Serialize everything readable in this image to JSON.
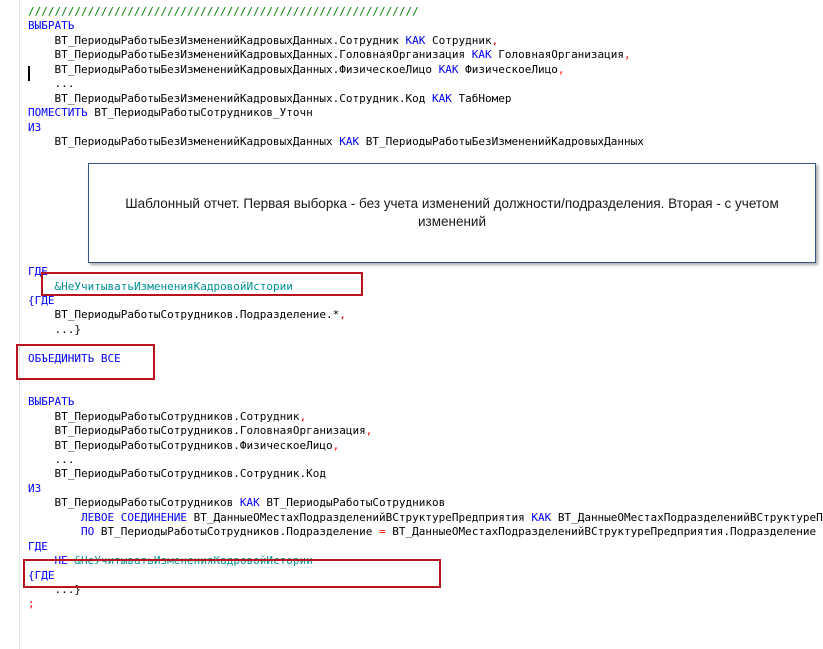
{
  "code_lines": [
    {
      "segs": [
        {
          "t": "///////////////////////////////////////////////////////////",
          "c": "cmt"
        }
      ]
    },
    {
      "segs": [
        {
          "t": "ВЫБРАТЬ",
          "c": "kw"
        }
      ]
    },
    {
      "segs": [
        {
          "t": "    ВТ_ПериодыРаботыБезИзмененийКадровыхДанных.Сотрудник ",
          "c": ""
        },
        {
          "t": "КАК",
          "c": "kw"
        },
        {
          "t": " Сотрудник",
          "c": ""
        },
        {
          "t": ",",
          "c": "op"
        }
      ]
    },
    {
      "segs": [
        {
          "t": "    ВТ_ПериодыРаботыБезИзмененийКадровыхДанных.ГоловнаяОрганизация ",
          "c": ""
        },
        {
          "t": "КАК",
          "c": "kw"
        },
        {
          "t": " ГоловнаяОрганизация",
          "c": ""
        },
        {
          "t": ",",
          "c": "op"
        }
      ]
    },
    {
      "segs": [
        {
          "t": "    ВТ_ПериодыРаботыБезИзмененийКадровыхДанных.ФизическоеЛицо ",
          "c": ""
        },
        {
          "t": "КАК",
          "c": "kw"
        },
        {
          "t": " ФизическоеЛицо",
          "c": ""
        },
        {
          "t": ",",
          "c": "op"
        }
      ]
    },
    {
      "segs": [
        {
          "t": "    ...",
          "c": ""
        }
      ]
    },
    {
      "segs": [
        {
          "t": "    ВТ_ПериодыРаботыБезИзмененийКадровыхДанных.Сотрудник.Код ",
          "c": ""
        },
        {
          "t": "КАК",
          "c": "kw"
        },
        {
          "t": " ТабНомер",
          "c": ""
        }
      ]
    },
    {
      "segs": [
        {
          "t": "ПОМЕСТИТЬ",
          "c": "kw"
        },
        {
          "t": " ВТ_ПериодыРаботыСотрудников_Уточн",
          "c": ""
        }
      ]
    },
    {
      "segs": [
        {
          "t": "ИЗ",
          "c": "kw"
        }
      ]
    },
    {
      "segs": [
        {
          "t": "    ВТ_ПериодыРаботыБезИзмененийКадровыхДанных ",
          "c": ""
        },
        {
          "t": "КАК",
          "c": "kw"
        },
        {
          "t": " ВТ_ПериодыРаботыБезИзмененийКадровыхДанных",
          "c": ""
        }
      ]
    },
    {
      "segs": [
        {
          "t": "",
          "c": ""
        }
      ]
    },
    {
      "segs": [
        {
          "t": "",
          "c": ""
        }
      ]
    },
    {
      "segs": [
        {
          "t": "",
          "c": ""
        }
      ]
    },
    {
      "segs": [
        {
          "t": "",
          "c": ""
        }
      ]
    },
    {
      "segs": [
        {
          "t": "",
          "c": ""
        }
      ]
    },
    {
      "segs": [
        {
          "t": "",
          "c": ""
        }
      ]
    },
    {
      "segs": [
        {
          "t": "",
          "c": ""
        }
      ]
    },
    {
      "segs": [
        {
          "t": "",
          "c": ""
        }
      ]
    },
    {
      "segs": [
        {
          "t": "ГДЕ",
          "c": "kw"
        }
      ]
    },
    {
      "segs": [
        {
          "t": "    ",
          "c": ""
        },
        {
          "t": "&НеУчитыватьИзмененияКадровойИстории",
          "c": "param"
        }
      ]
    },
    {
      "segs": [
        {
          "t": "{ГДЕ",
          "c": "kw"
        }
      ]
    },
    {
      "segs": [
        {
          "t": "    ВТ_ПериодыРаботыСотрудников.Подразделение.*",
          "c": ""
        },
        {
          "t": ",",
          "c": "op"
        }
      ]
    },
    {
      "segs": [
        {
          "t": "    ...}",
          "c": ""
        }
      ]
    },
    {
      "segs": [
        {
          "t": "",
          "c": ""
        }
      ]
    },
    {
      "segs": [
        {
          "t": "ОБЪЕДИНИТЬ ВСЕ",
          "c": "kw"
        }
      ]
    },
    {
      "segs": [
        {
          "t": "",
          "c": ""
        }
      ]
    },
    {
      "segs": [
        {
          "t": "",
          "c": ""
        }
      ]
    },
    {
      "segs": [
        {
          "t": "ВЫБРАТЬ",
          "c": "kw"
        }
      ]
    },
    {
      "segs": [
        {
          "t": "    ВТ_ПериодыРаботыСотрудников.Сотрудник",
          "c": ""
        },
        {
          "t": ",",
          "c": "op"
        }
      ]
    },
    {
      "segs": [
        {
          "t": "    ВТ_ПериодыРаботыСотрудников.ГоловнаяОрганизация",
          "c": ""
        },
        {
          "t": ",",
          "c": "op"
        }
      ]
    },
    {
      "segs": [
        {
          "t": "    ВТ_ПериодыРаботыСотрудников.ФизическоеЛицо",
          "c": ""
        },
        {
          "t": ",",
          "c": "op"
        }
      ]
    },
    {
      "segs": [
        {
          "t": "    ...",
          "c": ""
        }
      ]
    },
    {
      "segs": [
        {
          "t": "    ВТ_ПериодыРаботыСотрудников.Сотрудник.Код",
          "c": ""
        }
      ]
    },
    {
      "segs": [
        {
          "t": "ИЗ",
          "c": "kw"
        }
      ]
    },
    {
      "segs": [
        {
          "t": "    ВТ_ПериодыРаботыСотрудников ",
          "c": ""
        },
        {
          "t": "КАК",
          "c": "kw"
        },
        {
          "t": " ВТ_ПериодыРаботыСотрудников",
          "c": ""
        }
      ]
    },
    {
      "segs": [
        {
          "t": "        ",
          "c": ""
        },
        {
          "t": "ЛЕВОЕ СОЕДИНЕНИЕ",
          "c": "kw"
        },
        {
          "t": " ВТ_ДанныеОМестахПодразделенийВСтруктуреПредприятия ",
          "c": ""
        },
        {
          "t": "КАК",
          "c": "kw"
        },
        {
          "t": " ВТ_ДанныеОМестахПодразделенийВСтруктуреПредприятия",
          "c": ""
        }
      ]
    },
    {
      "segs": [
        {
          "t": "        ",
          "c": ""
        },
        {
          "t": "ПО",
          "c": "kw"
        },
        {
          "t": " ВТ_ПериодыРаботыСотрудников.Подразделение ",
          "c": ""
        },
        {
          "t": "=",
          "c": "op"
        },
        {
          "t": " ВТ_ДанныеОМестахПодразделенийВСтруктуреПредприятия.Подразделение",
          "c": ""
        }
      ]
    },
    {
      "segs": [
        {
          "t": "ГДЕ",
          "c": "kw"
        }
      ]
    },
    {
      "segs": [
        {
          "t": "    ",
          "c": ""
        },
        {
          "t": "НЕ",
          "c": "kw"
        },
        {
          "t": " ",
          "c": ""
        },
        {
          "t": "&НеУчитыватьИзмененияКадровойИстории",
          "c": "param"
        }
      ]
    },
    {
      "segs": [
        {
          "t": "{ГДЕ",
          "c": "kw"
        }
      ]
    },
    {
      "segs": [
        {
          "t": "    ...}",
          "c": ""
        }
      ]
    },
    {
      "segs": [
        {
          "t": ";",
          "c": "op"
        }
      ]
    }
  ],
  "tooltip": {
    "text": "Шаблонный отчет. Первая выборка - без учета изменений должности/подразделения. Вторая - с учетом изменений"
  },
  "colors": {
    "keyword": "#0000ff",
    "operator": "#ff0000",
    "parameter": "#009090",
    "comment": "#008000",
    "highlight_border": "#b81420",
    "tooltip_border": "#34578a"
  }
}
